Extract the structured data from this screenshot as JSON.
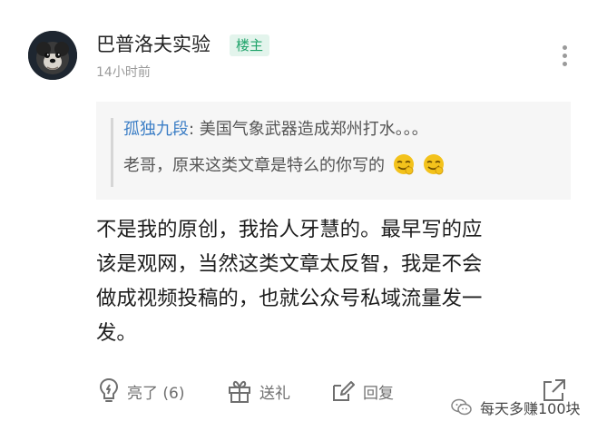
{
  "comment": {
    "author_name": "巴普洛夫实验",
    "author_badge": "楼主",
    "timestamp": "14小时前",
    "avatar_icon": "dog-avatar-icon",
    "more_icon": "more-vertical-icon"
  },
  "quote": {
    "author": "孤独九段",
    "separator": ": ",
    "line1_text": "美国气象武器造成郑州打水。。。",
    "line2_text": "老哥，原来这类文章是特么的你写的",
    "emoji_icon": "cunning-smile-emoji"
  },
  "reply": {
    "lines": [
      "不是我的原创，我拾人牙慧的。最早写的应",
      "该是观网，当然这类文章太反智，我是不会",
      "做成视频投稿的，也就公众号私域流量发一",
      "发。"
    ]
  },
  "actions": {
    "like_label": "亮了 (6)",
    "gift_label": "送礼",
    "reply_label": "回复",
    "like_icon": "lightbulb-icon",
    "gift_icon": "gift-icon",
    "reply_icon": "edit-reply-icon",
    "share_icon": "share-icon"
  },
  "watermark": {
    "text": "每天多赚100块",
    "icon": "wechat-icon"
  },
  "colors": {
    "badge_text": "#1fa36a",
    "badge_bg": "#e3f4ec",
    "quote_author": "#3d7fc6",
    "quote_bg": "#f6f6f6",
    "secondary_text": "#9a9a9a",
    "action_gray": "#6f6f6f"
  }
}
